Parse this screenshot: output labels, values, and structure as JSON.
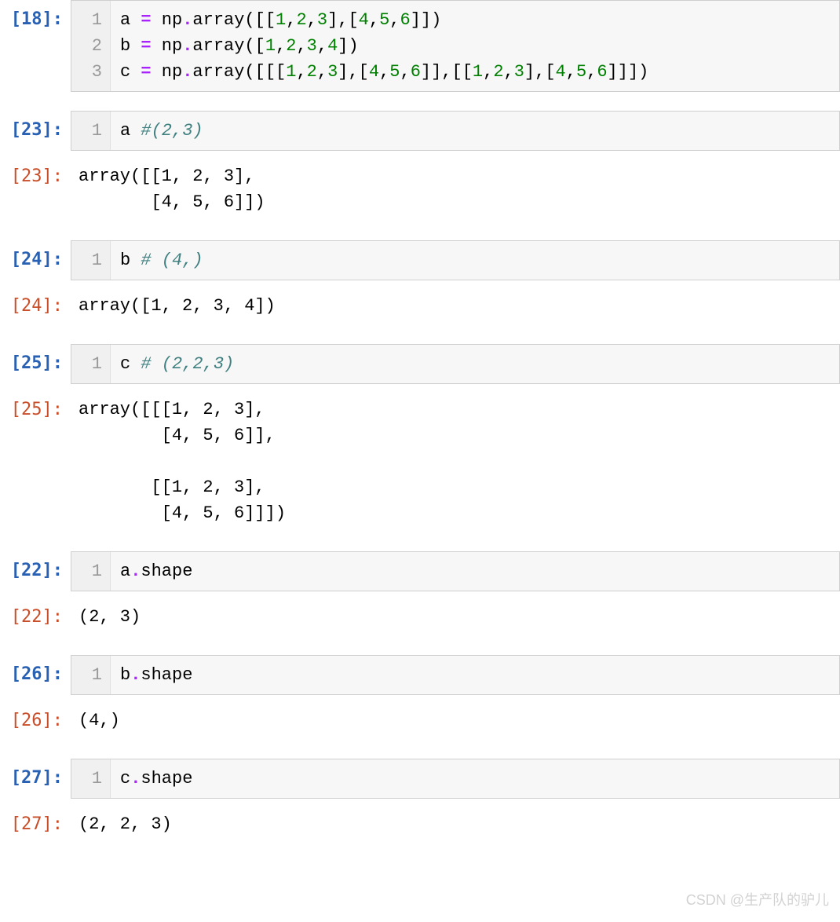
{
  "cells": [
    {
      "type": "in",
      "prompt": "[18]:",
      "lines": [
        "1",
        "2",
        "3"
      ],
      "code_html": "a <span class='op'>=</span> np<span class='op'>.</span>array([[<span class='num'>1</span>,<span class='num'>2</span>,<span class='num'>3</span>],[<span class='num'>4</span>,<span class='num'>5</span>,<span class='num'>6</span>]])\nb <span class='op'>=</span> np<span class='op'>.</span>array([<span class='num'>1</span>,<span class='num'>2</span>,<span class='num'>3</span>,<span class='num'>4</span>])\nc <span class='op'>=</span> np<span class='op'>.</span>array([[[<span class='num'>1</span>,<span class='num'>2</span>,<span class='num'>3</span>],[<span class='num'>4</span>,<span class='num'>5</span>,<span class='num'>6</span>]],[[<span class='num'>1</span>,<span class='num'>2</span>,<span class='num'>3</span>],[<span class='num'>4</span>,<span class='num'>5</span>,<span class='num'>6</span>]]])"
    },
    {
      "type": "in",
      "prompt": "[23]:",
      "lines": [
        "1"
      ],
      "code_html": "a <span class='comment'>#(2,3)</span>"
    },
    {
      "type": "out",
      "prompt": "[23]:",
      "output": "array([[1, 2, 3],\n       [4, 5, 6]])"
    },
    {
      "type": "in",
      "prompt": "[24]:",
      "lines": [
        "1"
      ],
      "code_html": "b <span class='comment'># (4,)</span>"
    },
    {
      "type": "out",
      "prompt": "[24]:",
      "output": "array([1, 2, 3, 4])"
    },
    {
      "type": "in",
      "prompt": "[25]:",
      "lines": [
        "1"
      ],
      "code_html": "c <span class='comment'># (2,2,3)</span>"
    },
    {
      "type": "out",
      "prompt": "[25]:",
      "output": "array([[[1, 2, 3],\n        [4, 5, 6]],\n\n       [[1, 2, 3],\n        [4, 5, 6]]])"
    },
    {
      "type": "in",
      "prompt": "[22]:",
      "lines": [
        "1"
      ],
      "code_html": "a<span class='op'>.</span>shape"
    },
    {
      "type": "out",
      "prompt": "[22]:",
      "output": "(2, 3)"
    },
    {
      "type": "in",
      "prompt": "[26]:",
      "lines": [
        "1"
      ],
      "code_html": "b<span class='op'>.</span>shape"
    },
    {
      "type": "out",
      "prompt": "[26]:",
      "output": "(4,)"
    },
    {
      "type": "in",
      "prompt": "[27]:",
      "lines": [
        "1"
      ],
      "code_html": "c<span class='op'>.</span>shape"
    },
    {
      "type": "out",
      "prompt": "[27]:",
      "output": "(2, 2, 3)"
    }
  ],
  "watermark": "CSDN @生产队的驴儿"
}
